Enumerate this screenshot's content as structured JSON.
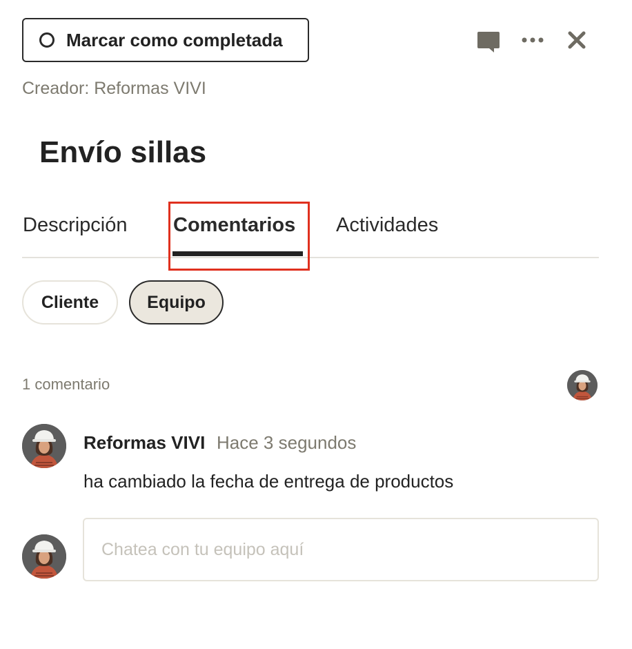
{
  "header": {
    "complete_button_label": "Marcar como completada",
    "icons": [
      "chat-bubble-icon",
      "more-icon",
      "close-icon"
    ]
  },
  "task": {
    "creator": "Creador: Reformas VIVI",
    "title": "Envío sillas"
  },
  "tabs": [
    {
      "label": "Descripción",
      "active": false
    },
    {
      "label": "Comentarios",
      "active": true
    },
    {
      "label": "Actividades",
      "active": false
    }
  ],
  "filters": [
    {
      "label": "Cliente",
      "selected": false
    },
    {
      "label": "Equipo",
      "selected": true
    }
  ],
  "comments_section": {
    "count_label": "1 comentario",
    "items": [
      {
        "author": "Reformas VIVI",
        "time": "Hace 3 segundos",
        "text": "ha cambiado la fecha de entrega de productos"
      }
    ]
  },
  "chat": {
    "placeholder": "Chatea con tu equipo aquí",
    "value": ""
  },
  "colors": {
    "highlight": "#e0301e",
    "muted_text": "#7d7a6f",
    "selected_pill_bg": "#ebe7de"
  }
}
